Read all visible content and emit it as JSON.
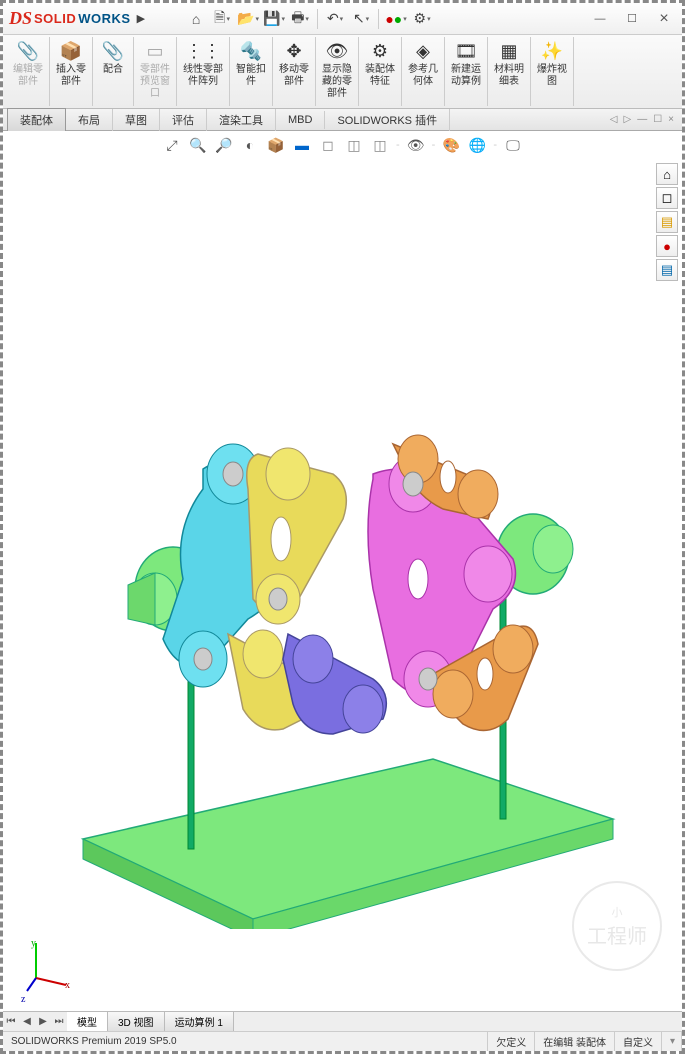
{
  "app": {
    "name_solid": "SOLID",
    "name_works": "WORKS"
  },
  "quickbar_icons": [
    "home-icon",
    "new-icon",
    "open-icon",
    "save-icon",
    "print-icon",
    "undo-icon",
    "redo-icon",
    "select-icon",
    "options-icon"
  ],
  "win": {
    "min": "—",
    "max": "☐",
    "close": "×"
  },
  "ribbon": [
    {
      "id": "edit-part",
      "label": "编辑零\n部件",
      "disabled": true,
      "icon": "📎"
    },
    {
      "id": "insert-comp",
      "label": "插入零\n部件",
      "icon": "📦"
    },
    {
      "id": "mate",
      "label": "配合",
      "icon": "📎"
    },
    {
      "id": "preview",
      "label": "零部件\n预览窗\n口",
      "disabled": true,
      "icon": "▭"
    },
    {
      "id": "linear-pattern",
      "label": "线性零部\n件阵列",
      "icon": "⋮⋮"
    },
    {
      "id": "smart-fastener",
      "label": "智能扣\n件",
      "icon": "🔩"
    },
    {
      "id": "move-comp",
      "label": "移动零\n部件",
      "icon": "✥"
    },
    {
      "id": "show-hide",
      "label": "显示隐\n藏的零\n部件",
      "icon": "👁"
    },
    {
      "id": "assembly-feat",
      "label": "装配体\n特征",
      "icon": "⚙"
    },
    {
      "id": "ref-geom",
      "label": "参考几\n何体",
      "icon": "◈"
    },
    {
      "id": "new-motion",
      "label": "新建运\n动算例",
      "icon": "🎞"
    },
    {
      "id": "bom",
      "label": "材料明\n细表",
      "icon": "▦"
    },
    {
      "id": "exploded",
      "label": "爆炸视\n图",
      "icon": "✨"
    }
  ],
  "tabs": [
    {
      "id": "assembly",
      "label": "装配体",
      "active": true
    },
    {
      "id": "layout",
      "label": "布局"
    },
    {
      "id": "sketch",
      "label": "草图"
    },
    {
      "id": "evaluate",
      "label": "评估"
    },
    {
      "id": "render",
      "label": "渲染工具"
    },
    {
      "id": "mbd",
      "label": "MBD"
    },
    {
      "id": "addins",
      "label": "SOLIDWORKS 插件"
    }
  ],
  "side_panel": [
    {
      "id": "home",
      "glyph": "⌂"
    },
    {
      "id": "cube",
      "glyph": "◻"
    },
    {
      "id": "sheet",
      "glyph": "▤",
      "color": "#d99a00"
    },
    {
      "id": "appearance",
      "glyph": "●",
      "color": "#c00"
    },
    {
      "id": "props",
      "glyph": "▤",
      "color": "#0066aa"
    }
  ],
  "bottom_tabs": [
    {
      "id": "model",
      "label": "模型",
      "active": true
    },
    {
      "id": "3dview",
      "label": "3D 视图"
    },
    {
      "id": "motion1",
      "label": "运动算例 1"
    }
  ],
  "status": {
    "version": "SOLIDWORKS Premium 2019 SP5.0",
    "def": "欠定义",
    "editing": "在编辑 装配体",
    "custom": "自定义"
  },
  "triad": {
    "x": "x",
    "y": "y",
    "z": "z"
  },
  "watermark": "工程师"
}
